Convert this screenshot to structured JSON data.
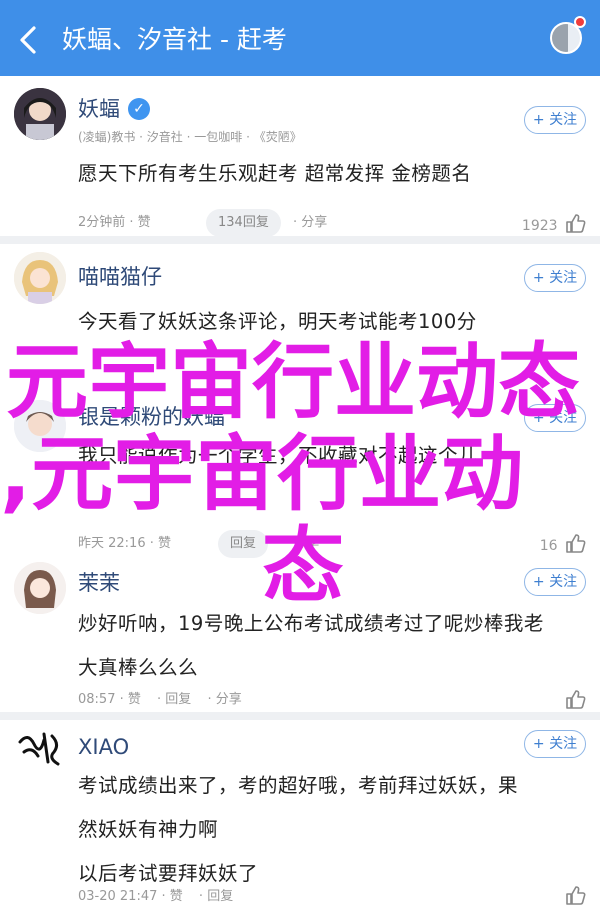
{
  "header": {
    "title": "妖蝠、汐音社 - 赶考"
  },
  "comments": [
    {
      "name": "妖蝠",
      "meta": "(凌蝠)教书 · 汐音社 · 一包咖啡 · 《荧陋》",
      "text_lines": [
        "愿天下所有考生乐观赶考 超常发挥 金榜题名"
      ],
      "time": "2分钟前 · 赞",
      "replies": "134回复",
      "share": "分享",
      "likes": "1923",
      "follow": "+ 关注"
    },
    {
      "name": "喵喵猫仔",
      "text_lines": [
        "今天看了妖妖这条评论，明天考试能考100分"
      ],
      "follow": "+ 关注"
    },
    {
      "name": "银是颗粉的妖蝠",
      "text_lines": [
        "我只能说作为一个学生，不收藏对不起这个儿"
      ],
      "time": "昨天 22:16 · 赞",
      "replies": "回复",
      "share": "分享",
      "likes": "16",
      "follow": "+ 关注"
    },
    {
      "name": "茉茉",
      "text_lines": [
        "炒好听呐，19号晚上公布考试成绩考过了呢炒棒我老",
        "大真棒么么么"
      ],
      "time": "08:57 · 赞",
      "replies": "回复",
      "share": "分享",
      "likes": "",
      "follow": "+ 关注"
    },
    {
      "name": "XIAO",
      "text_lines": [
        "考试成绩出来了，考的超好哦，考前拜过妖妖，果",
        "然妖妖有神力啊",
        "以后考试要拜妖妖了"
      ],
      "time": "03-20 21:47 · 赞",
      "replies": "回复",
      "likes": "",
      "follow": "+ 关注"
    }
  ],
  "banner": {
    "line1": "元宇宙行业动态",
    "line2": ",元宇宙行业动",
    "line3": "态"
  },
  "colors": {
    "header_bg": "#3f8fe8",
    "banner_text": "#e21de6",
    "name_text": "#2f4a78"
  }
}
